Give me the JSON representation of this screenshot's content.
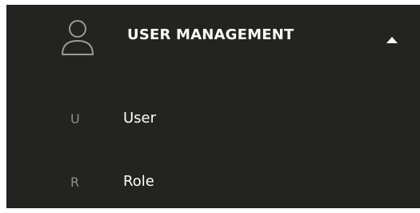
{
  "section": {
    "title": "USER MANAGEMENT",
    "icon": "user-icon",
    "expanded": true,
    "chevron_icon": "chevron-up-icon"
  },
  "items": [
    {
      "letter": "U",
      "label": "User"
    },
    {
      "letter": "R",
      "label": "Role"
    }
  ],
  "colors": {
    "panel_background": "#232321",
    "text": "#ffffff",
    "muted_letter": "#8f8f8c",
    "icon_stroke": "#9a9a97"
  }
}
